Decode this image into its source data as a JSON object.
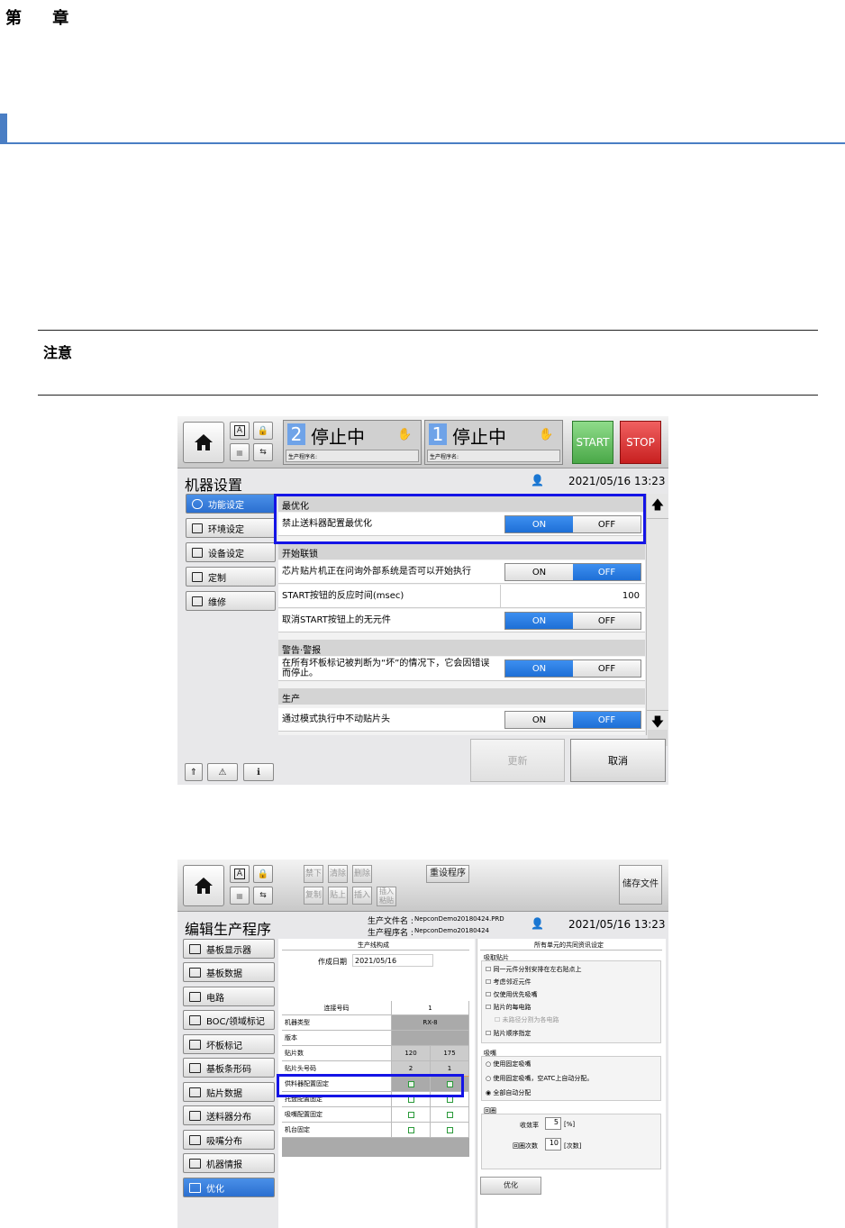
{
  "doc": {
    "chapter": "第 章",
    "note_title": "注意"
  },
  "s1": {
    "station2": {
      "num": "2",
      "status": "停止中",
      "prog": "生产程序名:"
    },
    "station1": {
      "num": "1",
      "status": "停止中",
      "prog": "生产程序名:"
    },
    "start": "START",
    "stop": "STOP",
    "title": "机器设置",
    "datetime": "2021/05/16 13:23",
    "sidebar": [
      "功能设定",
      "环境设定",
      "设备设定",
      "定制",
      "维修"
    ],
    "groups": {
      "g1": "最优化",
      "g2": "开始联锁",
      "g3": "警告·警报",
      "g4": "生产"
    },
    "rows": {
      "r1": "禁止送料器配置最优化",
      "r2": "芯片贴片机正在问询外部系统是否可以开始执行",
      "r3": "START按钮的反应时间(msec)",
      "r3val": "100",
      "r4": "取消START按钮上的无元件",
      "r5": "在所有坏板标记被判断为“坏”的情况下，它会因错误而停止。",
      "r6": "通过模式执行中不动贴片头"
    },
    "on": "ON",
    "off": "OFF",
    "update": "更新",
    "cancel": "取消"
  },
  "s2": {
    "tools": {
      "t1": "禁下",
      "t2": "清除",
      "t3": "删除",
      "t4": "复制",
      "t5": "贴上",
      "t6": "插入",
      "t7": "插入粘贴",
      "reset": "重设程序",
      "save": "储存文件"
    },
    "title": "编辑生产程序",
    "file_label": "生产文件名 :",
    "file_name": "NepconDemo20180424.PRD",
    "prog_label": "生产程序名 :",
    "prog_name": "NepconDemo20180424",
    "datetime": "2021/05/16 13:23",
    "sidebar": [
      "基板显示器",
      "基板数据",
      "电路",
      "BOC/领域标记",
      "坏板标记",
      "基板条形码",
      "贴片数据",
      "送料器分布",
      "吸嘴分布",
      "机器情报",
      "优化"
    ],
    "left_head": "生产线构成",
    "date_label": "作成日期",
    "date_val": "2021/05/16",
    "table": {
      "hdr": "连接号码",
      "hdr_val": "1",
      "r_type": "机器类型",
      "r_type_val": "RX-8",
      "r_ver": "版本",
      "r_cnt": "贴片数",
      "cnt1": "120",
      "cnt2": "175",
      "r_head": "贴片头号码",
      "head1": "2",
      "head2": "1",
      "r_feed": "供料器配置固定",
      "r_tray": "托盘配置固定",
      "r_noz": "吸嘴配置固定",
      "r_mach": "机台固定"
    },
    "right_head": "所有单元的共同资讯设定",
    "pick": {
      "title": "吸取贴片",
      "o1": "同一元件分别安排在左右贴点上",
      "o2": "考虑邻近元件",
      "o3": "仅使用优先吸嘴",
      "o4": "贴片的每电路",
      "o4a": "未路径分割为各电路",
      "o5": "贴片顺序指定"
    },
    "nozzle": {
      "title": "吸嘴",
      "o1": "使用固定吸嘴",
      "o2": "使用固定吸嘴，空ATC上自动分配。",
      "o3": "全部自动分配"
    },
    "loop": {
      "title": "回圈",
      "eff": "收敛率",
      "eff_val": "5",
      "eff_unit": "[%]",
      "cnt": "回圈次数",
      "cnt_val": "10",
      "cnt_unit": "[次数]"
    },
    "opt_btn": "优化"
  }
}
